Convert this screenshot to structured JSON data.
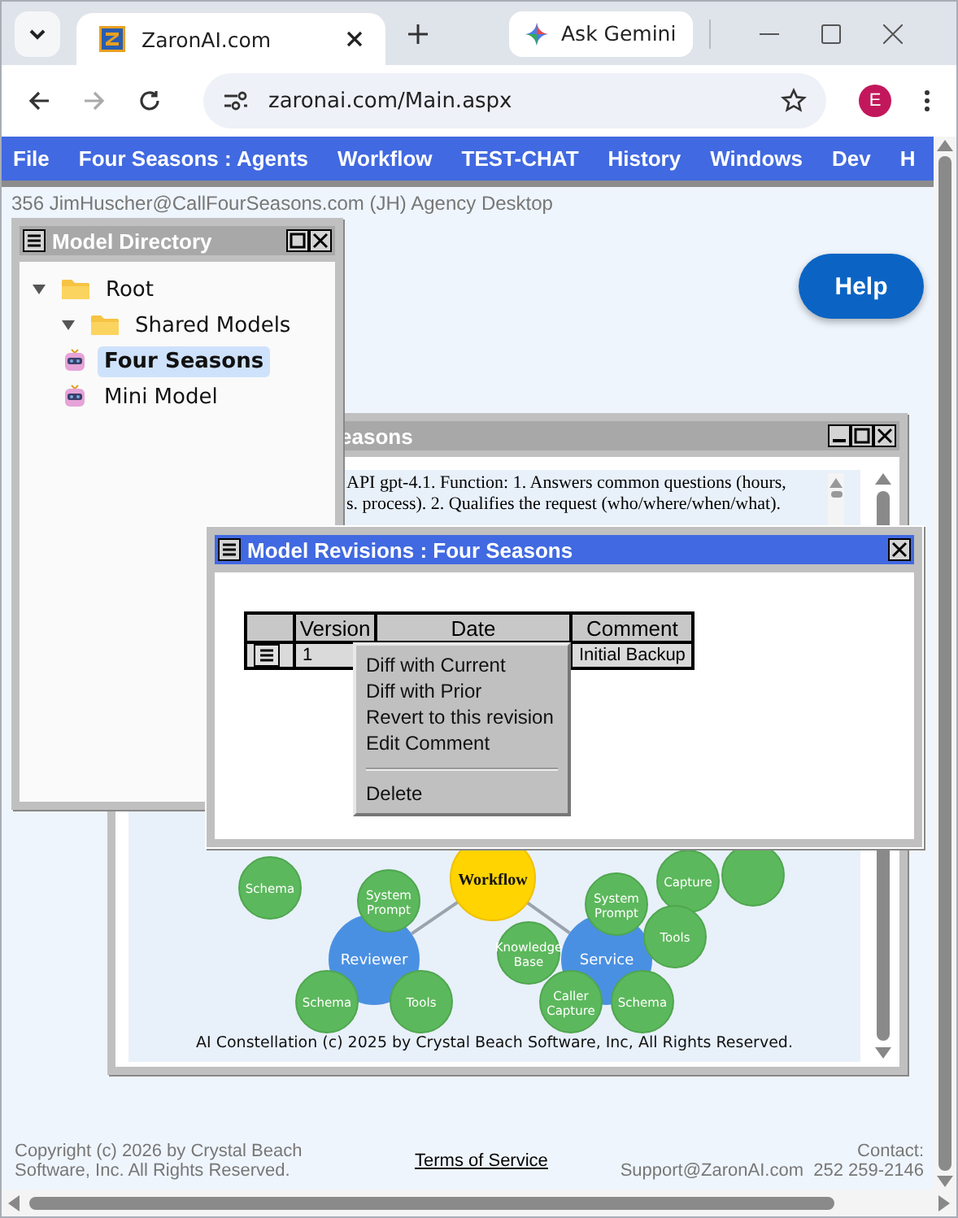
{
  "browser": {
    "tabs": [
      {
        "title": "ZaronAI.com",
        "selected": true
      }
    ],
    "gemini_button": "Ask Gemini",
    "address": "zaronai.com/Main.aspx",
    "profile_initial": "E",
    "forward_disabled": true
  },
  "menu_bar": [
    "File",
    "Four Seasons : Agents",
    "Workflow",
    "TEST-CHAT",
    "History",
    "Windows",
    "Dev",
    "H"
  ],
  "status_line": "356 JimHuscher@CallFourSeasons.com (JH) Agency Desktop",
  "help_button": "Help",
  "model_directory": {
    "title": "Model Directory",
    "tree": [
      {
        "label": "Root",
        "kind": "folder",
        "expanded": true,
        "selected": false,
        "children": [
          {
            "label": "Shared Models",
            "kind": "folder",
            "expanded": true,
            "selected": false
          },
          {
            "label": "Four Seasons",
            "kind": "model",
            "selected": true
          },
          {
            "label": "Mini Model",
            "kind": "model",
            "selected": false
          }
        ]
      }
    ]
  },
  "model_window": {
    "title": "easons",
    "description": [
      "API gpt-4.1. Function: 1. Answers common questions (hours,",
      "s. process). 2. Qualifies the request (who/where/when/what)."
    ],
    "constellation": {
      "workflow": "Workflow",
      "agents": [
        {
          "label": "Reviewer",
          "parts": [
            "System Prompt",
            "Schema",
            "Tools"
          ]
        },
        {
          "label": "Service",
          "parts": [
            "System Prompt",
            "Knowledge Base",
            "Tools",
            "Caller Capture",
            "Schema"
          ]
        }
      ],
      "other_parts": [
        "Schema",
        "Capture"
      ],
      "caption": "AI Constellation (c) 2025 by Crystal Beach Software, Inc, All Rights Reserved."
    }
  },
  "revisions": {
    "title": "Model Revisions : Four Seasons",
    "columns": [
      "Version",
      "Date",
      "Comment"
    ],
    "rows": [
      {
        "version": "1",
        "comment": "Initial Backup"
      }
    ],
    "context_menu": [
      {
        "kind": "item",
        "label": "Diff with Current"
      },
      {
        "kind": "item",
        "label": "Diff with Prior"
      },
      {
        "kind": "item",
        "label": "Revert to this revision"
      },
      {
        "kind": "item",
        "label": "Edit Comment"
      },
      {
        "kind": "separator"
      },
      {
        "kind": "item",
        "label": "Delete"
      }
    ]
  },
  "footer": {
    "copyright": "Copyright (c) 2026 by Crystal Beach Software, Inc. All Rights Reserved.",
    "terms_link": "Terms of Service",
    "contact_label": "Contact:",
    "contact": "Support@ZaronAI.com  252 259-2146"
  }
}
